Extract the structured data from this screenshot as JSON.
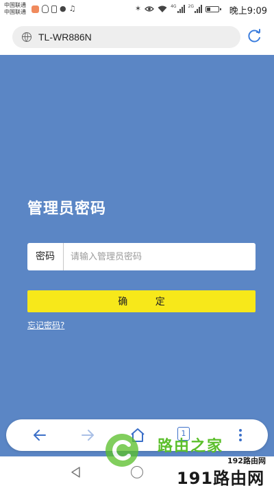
{
  "status_bar": {
    "carrier_line1": "中国联通",
    "carrier_line2": "中国联通",
    "network_1": "4G",
    "network_2": "2G",
    "time": "晚上9:09"
  },
  "browser": {
    "url": "TL-WR886N",
    "tab_count": "1"
  },
  "login": {
    "heading": "管理员密码",
    "password_label": "密码",
    "password_placeholder": "请输入管理员密码",
    "password_value": "",
    "confirm_label": "确 定",
    "forgot_link": "忘记密码?"
  },
  "watermark": {
    "brand_cn": "路由之家",
    "site_small": "192路由网",
    "site_large": "191路由网"
  },
  "colors": {
    "page_background": "#5b86c5",
    "confirm_button": "#f7e81a",
    "toolbar_icon": "#3b6fc8"
  }
}
